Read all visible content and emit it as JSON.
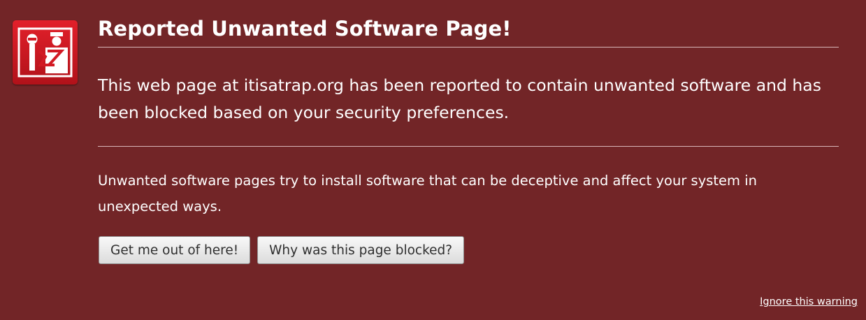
{
  "icon": {
    "name": "unwanted-software-icon"
  },
  "error": {
    "title": "Reported Unwanted Software Page!",
    "short_description": "This web page at itisatrap.org has been reported to contain unwanted software and has been blocked based on your security preferences.",
    "long_description": "Unwanted software pages try to install software that can be deceptive and affect your system in unexpected ways."
  },
  "buttons": {
    "get_out_label": "Get me out of here!",
    "why_blocked_label": "Why was this page blocked?"
  },
  "ignore_warning_label": "Ignore this warning",
  "colors": {
    "background": "#722527",
    "icon_red": "#d21a24",
    "text": "#ffffff"
  }
}
